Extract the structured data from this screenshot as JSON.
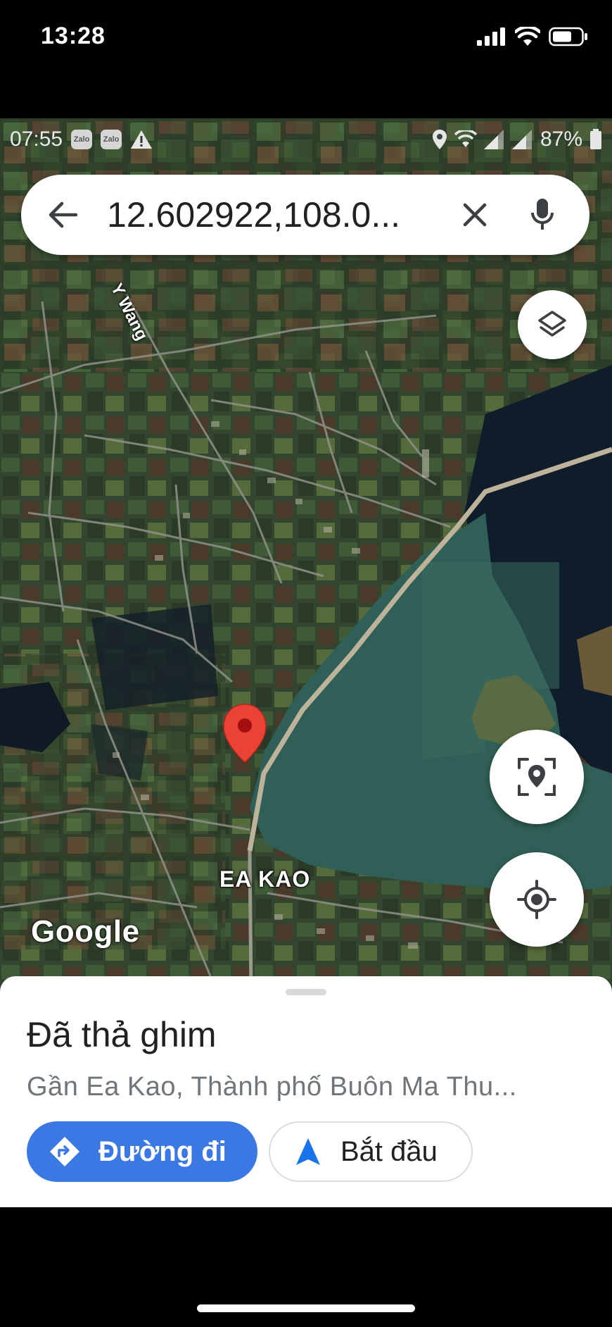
{
  "ios_status": {
    "time": "13:28",
    "icons": [
      "cellular-signal-icon",
      "wifi-icon",
      "battery-icon"
    ]
  },
  "android_status": {
    "time": "07:55",
    "app_badges": [
      "Zalo",
      "Zalo"
    ],
    "battery_percent": "87%"
  },
  "search": {
    "query": "12.602922,108.0..."
  },
  "map": {
    "labels": {
      "road": "Y Wang",
      "place": "EA KAO"
    },
    "watermark": "Google",
    "colors": {
      "lake": "#2f5f56",
      "deep_water": "#0f1d2a",
      "pin": "#ea4335"
    }
  },
  "sheet": {
    "title": "Đã thả ghim",
    "subtitle": "Gần Ea Kao, Thành phố Buôn Ma Thu...",
    "directions_label": "Đường đi",
    "start_label": "Bắt đầu",
    "accent_color": "#3c78e4"
  }
}
